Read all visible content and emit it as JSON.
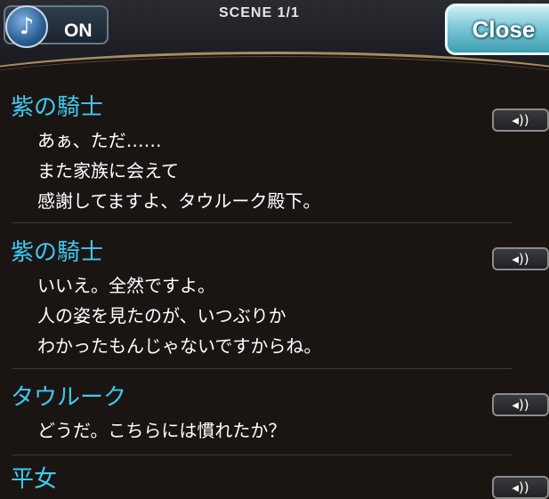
{
  "header": {
    "sound_label": "ON",
    "sound_icon": "music-note-icon",
    "scene_label": "SCENE 1/1",
    "close_label": "Close"
  },
  "log": [
    {
      "speaker": "紫の騎士",
      "lines": [
        "あぁ、ただ……",
        "また家族に会えて",
        "感謝してますよ、タウルーク殿下。"
      ]
    },
    {
      "speaker": "紫の騎士",
      "lines": [
        "いいえ。全然ですよ。",
        "人の姿を見たのが、いつぶりか",
        "わかったもんじゃないですからね。"
      ]
    },
    {
      "speaker": "タウルーク",
      "lines": [
        "どうだ。こちらには慣れたか？"
      ]
    },
    {
      "speaker": "平女",
      "lines": []
    }
  ],
  "colors": {
    "speaker": "#42c8ee",
    "text": "#ffffff",
    "close_button": "#7cc9d8"
  }
}
